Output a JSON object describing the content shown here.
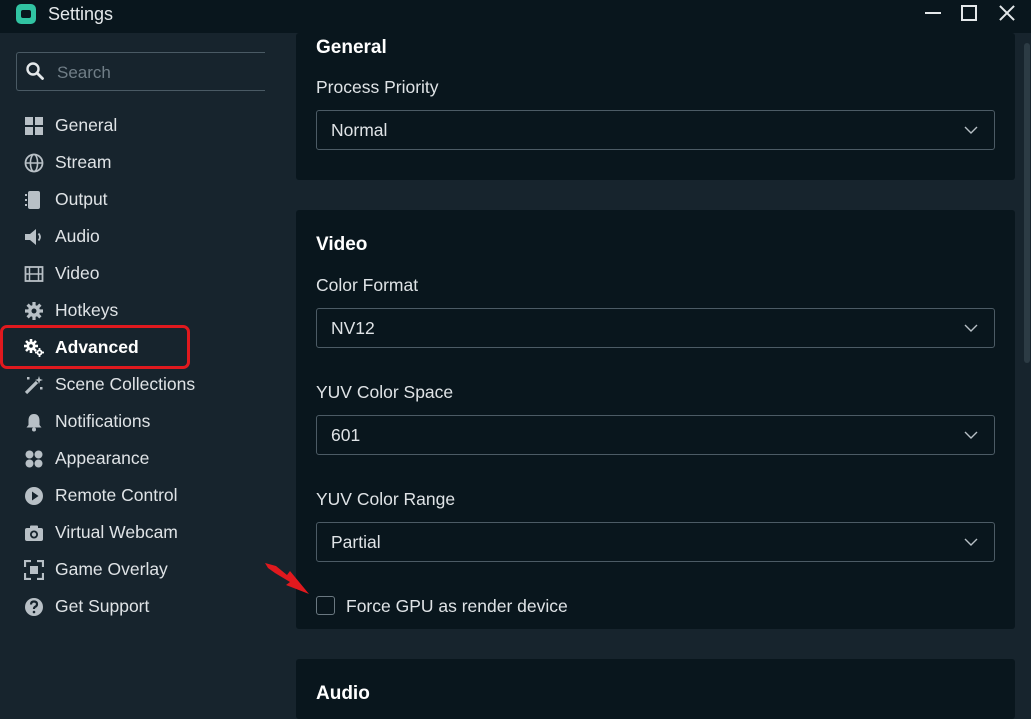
{
  "window": {
    "title": "Settings"
  },
  "search": {
    "placeholder": "Search"
  },
  "sidebar": {
    "items": [
      {
        "label": "General",
        "icon": "grid-icon"
      },
      {
        "label": "Stream",
        "icon": "globe-icon"
      },
      {
        "label": "Output",
        "icon": "output-icon"
      },
      {
        "label": "Audio",
        "icon": "speaker-icon"
      },
      {
        "label": "Video",
        "icon": "film-icon"
      },
      {
        "label": "Hotkeys",
        "icon": "gear-icon"
      },
      {
        "label": "Advanced",
        "icon": "gears-icon",
        "active": true
      },
      {
        "label": "Scene Collections",
        "icon": "magic-wand-icon"
      },
      {
        "label": "Notifications",
        "icon": "bell-icon"
      },
      {
        "label": "Appearance",
        "icon": "palette-icon"
      },
      {
        "label": "Remote Control",
        "icon": "play-circle-icon"
      },
      {
        "label": "Virtual Webcam",
        "icon": "camera-icon"
      },
      {
        "label": "Game Overlay",
        "icon": "expand-icon"
      },
      {
        "label": "Get Support",
        "icon": "question-icon"
      }
    ]
  },
  "main": {
    "general": {
      "title": "General",
      "process_priority": {
        "label": "Process Priority",
        "value": "Normal"
      }
    },
    "video": {
      "title": "Video",
      "color_format": {
        "label": "Color Format",
        "value": "NV12"
      },
      "yuv_color_space": {
        "label": "YUV Color Space",
        "value": "601"
      },
      "yuv_color_range": {
        "label": "YUV Color Range",
        "value": "Partial"
      },
      "force_gpu": {
        "label": "Force GPU as render device",
        "checked": false
      }
    },
    "audio": {
      "title": "Audio"
    }
  },
  "colors": {
    "background": "#17242d",
    "card": "#09161d",
    "accent": "#31c3a2",
    "highlight": "#e0191e"
  }
}
